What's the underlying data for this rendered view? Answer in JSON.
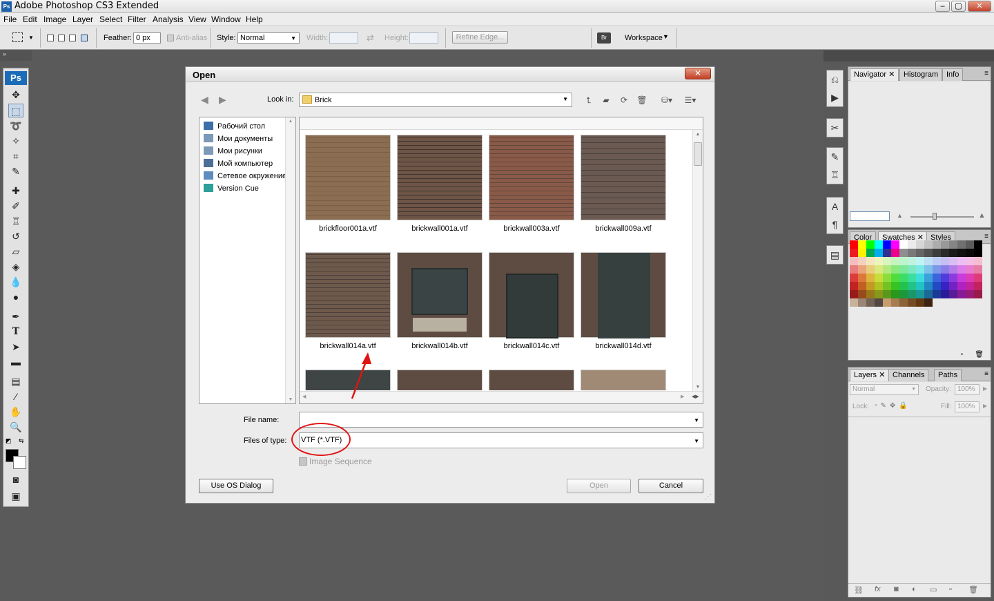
{
  "app": {
    "title": "Adobe Photoshop CS3 Extended",
    "icon_label": "Ps"
  },
  "window_buttons": {
    "minimize": "–",
    "maximize": "▢",
    "close": "✕"
  },
  "menu": [
    "File",
    "Edit",
    "Image",
    "Layer",
    "Select",
    "Filter",
    "Analysis",
    "View",
    "Window",
    "Help"
  ],
  "options": {
    "feather_label": "Feather:",
    "feather_value": "0 px",
    "antialias_label": "Anti-alias",
    "style_label": "Style:",
    "style_value": "Normal",
    "width_label": "Width:",
    "height_label": "Height:",
    "refine_edge": "Refine Edge...",
    "workspace": "Workspace"
  },
  "toolbox": {
    "logo": "Ps"
  },
  "panels": {
    "top_tabs": [
      "Navigator",
      "Histogram",
      "Info"
    ],
    "mid_tabs": [
      "Color",
      "Swatches",
      "Styles"
    ],
    "bottom_tabs": [
      "Layers",
      "Channels",
      "Paths"
    ],
    "layers": {
      "blend_mode": "Normal",
      "opacity_label": "Opacity:",
      "opacity_value": "100%",
      "lock_label": "Lock:",
      "fill_label": "Fill:",
      "fill_value": "100%"
    }
  },
  "dialog": {
    "title": "Open",
    "close_label": "✕",
    "look_in_label": "Look in:",
    "look_in_value": "Brick",
    "places": [
      "Рабочий стол",
      "Мои документы",
      "Мои рисунки",
      "Мой компьютер",
      "Сетевое окружение",
      "Version Cue"
    ],
    "files": [
      "brickfloor001a.vtf",
      "brickwall001a.vtf",
      "brickwall003a.vtf",
      "brickwall009a.vtf",
      "brickwall014a.vtf",
      "brickwall014b.vtf",
      "brickwall014c.vtf",
      "brickwall014d.vtf"
    ],
    "file_name_label": "File name:",
    "file_name_value": "",
    "files_of_type_label": "Files of type:",
    "files_of_type_value": "VTF (*.VTF)",
    "image_sequence_label": "Image Sequence",
    "use_os_dialog": "Use OS Dialog",
    "open_button": "Open",
    "cancel_button": "Cancel"
  },
  "colors": {
    "workspace_bg": "#5a5a5a",
    "annotation_red": "#e01414",
    "brick_1": "#8b6e52",
    "brick_2": "#6e5546",
    "brick_3": "#8a5a48",
    "brick_4": "#6a5a52"
  }
}
